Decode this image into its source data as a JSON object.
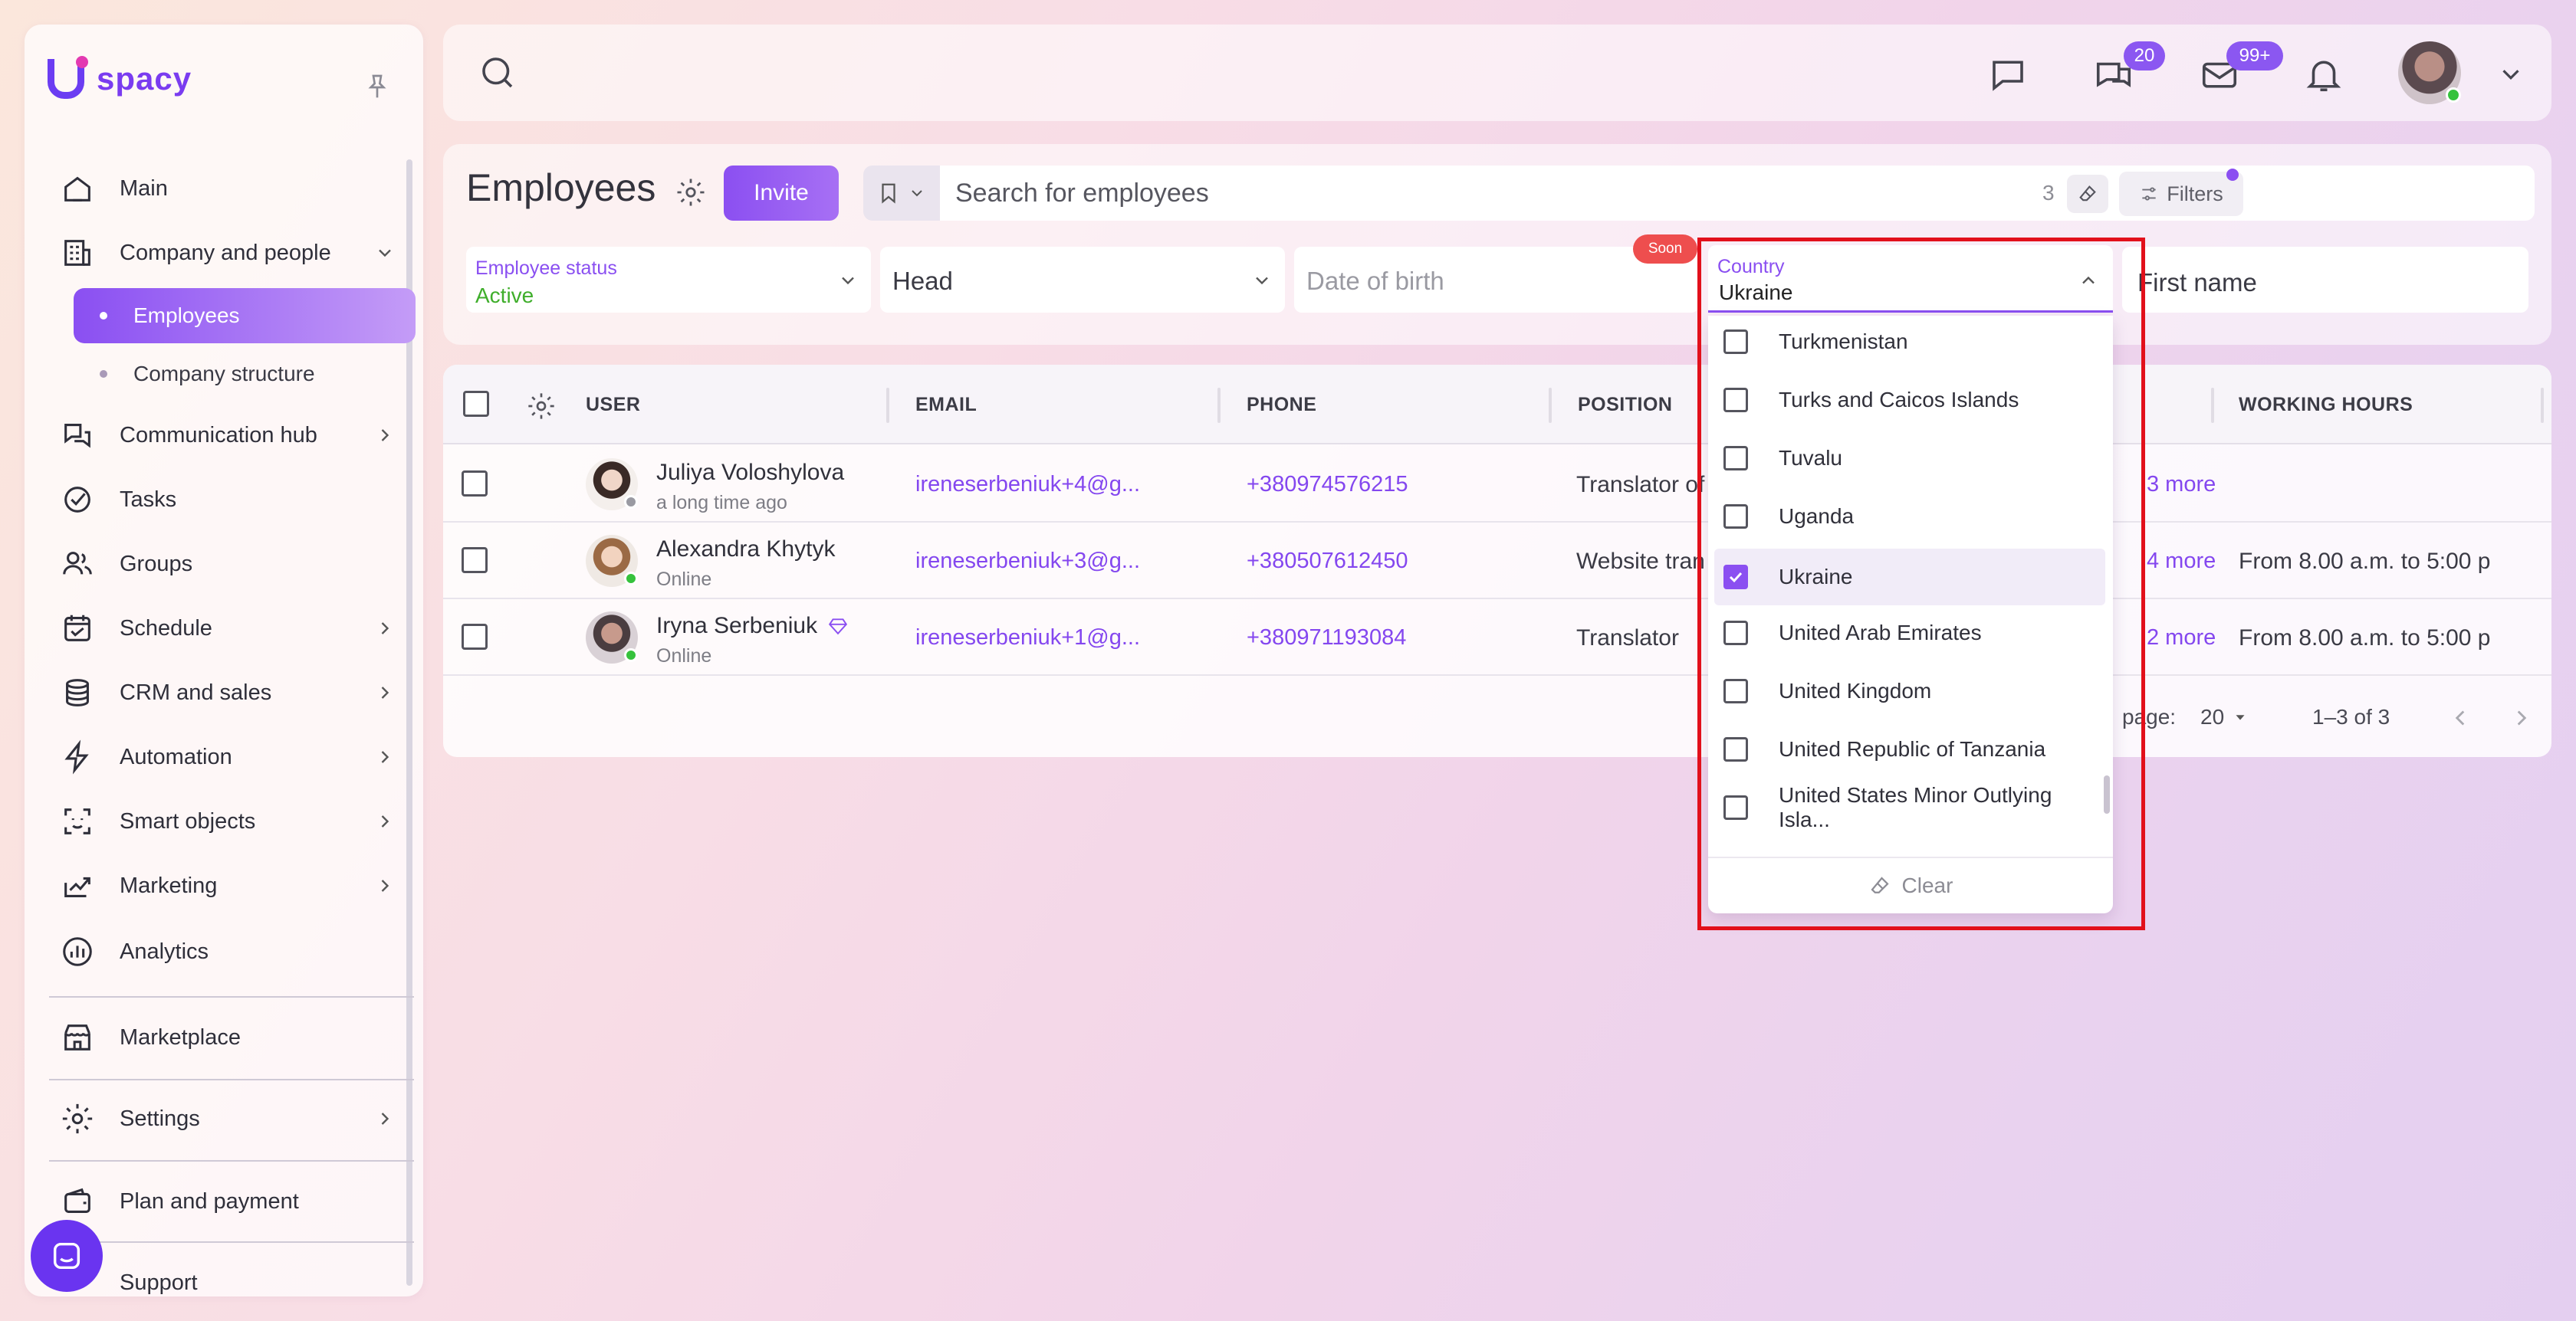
{
  "app": {
    "logo_text": "spacy",
    "accent_color": "#8b4ff1"
  },
  "sidebar": {
    "items": [
      {
        "label": "Main",
        "icon": "home-icon"
      },
      {
        "label": "Company and people",
        "icon": "building-icon"
      },
      {
        "label": "Communication hub",
        "icon": "chat-hub-icon"
      },
      {
        "label": "Tasks",
        "icon": "check-circle-icon"
      },
      {
        "label": "Groups",
        "icon": "users-icon"
      },
      {
        "label": "Schedule",
        "icon": "calendar-icon"
      },
      {
        "label": "CRM and sales",
        "icon": "coins-icon"
      },
      {
        "label": "Automation",
        "icon": "lightning-icon"
      },
      {
        "label": "Smart objects",
        "icon": "smart-face-icon"
      },
      {
        "label": "Marketing",
        "icon": "marketing-icon"
      },
      {
        "label": "Analytics",
        "icon": "chart-icon"
      },
      {
        "label": "Marketplace",
        "icon": "store-icon"
      },
      {
        "label": "Settings",
        "icon": "gear-icon"
      },
      {
        "label": "Plan and payment",
        "icon": "wallet-icon"
      },
      {
        "label": "Support",
        "icon": "support-icon"
      }
    ],
    "sub_items": [
      "Employees",
      "Company structure"
    ]
  },
  "topbar": {
    "chat_badge": "20",
    "mail_badge": "99+"
  },
  "employees": {
    "title": "Employees",
    "invite_label": "Invite",
    "search_placeholder": "Search for employees",
    "search_count": "3",
    "filters_label": "Filters",
    "filters": {
      "status_label": "Employee status",
      "status_value": "Active",
      "head_placeholder": "Head",
      "dob_placeholder": "Date of birth",
      "soon_badge": "Soon",
      "country_label": "Country",
      "country_value": "Ukraine",
      "first_name_placeholder": "First name"
    }
  },
  "table": {
    "headers": {
      "user": "USER",
      "email": "EMAIL",
      "phone": "PHONE",
      "position": "POSITION",
      "working_hours": "WORKING HOURS"
    },
    "rows": [
      {
        "name": "Juliya Voloshylova",
        "status": "a long time ago",
        "email": "ireneserbeniuk+4@g...",
        "phone": "+380974576215",
        "position": "Translator of",
        "more": "3 more",
        "hours": ""
      },
      {
        "name": "Alexandra Khytyk",
        "status": "Online",
        "email": "ireneserbeniuk+3@g...",
        "phone": "+380507612450",
        "position": "Website tran",
        "more": "4 more",
        "hours": "From 8.00 a.m. to 5:00 p"
      },
      {
        "name": "Iryna Serbeniuk",
        "status": "Online",
        "email": "ireneserbeniuk+1@g...",
        "phone": "+380971193084",
        "position": "Translator",
        "more": "2 more",
        "hours": "From 8.00 a.m. to 5:00 p"
      }
    ],
    "pager": {
      "per_page_label": "page:",
      "per_page_value": "20",
      "range": "1–3 of 3"
    }
  },
  "country_dropdown": {
    "options": [
      {
        "label": "Turkmenistan",
        "checked": false
      },
      {
        "label": "Turks and Caicos Islands",
        "checked": false
      },
      {
        "label": "Tuvalu",
        "checked": false
      },
      {
        "label": "Uganda",
        "checked": false
      },
      {
        "label": "Ukraine",
        "checked": true
      },
      {
        "label": "United Arab Emirates",
        "checked": false
      },
      {
        "label": "United Kingdom",
        "checked": false
      },
      {
        "label": "United Republic of Tanzania",
        "checked": false
      },
      {
        "label": "United States Minor Outlying Isla...",
        "checked": false
      }
    ],
    "clear_label": "Clear"
  }
}
